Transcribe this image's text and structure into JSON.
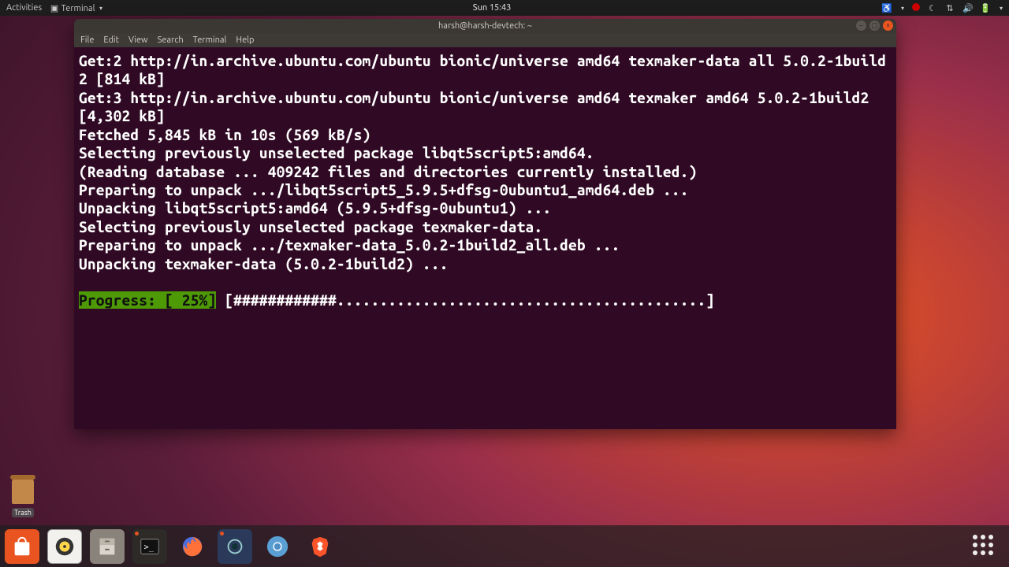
{
  "topbar": {
    "activities": "Activities",
    "app_indicator": "Terminal",
    "clock": "Sun 15:43"
  },
  "terminal": {
    "title": "harsh@harsh-devtech: ~",
    "menu": [
      "File",
      "Edit",
      "View",
      "Search",
      "Terminal",
      "Help"
    ],
    "lines": [
      "Get:2 http://in.archive.ubuntu.com/ubuntu bionic/universe amd64 texmaker-data all 5.0.2-1build2 [814 kB]",
      "Get:3 http://in.archive.ubuntu.com/ubuntu bionic/universe amd64 texmaker amd64 5.0.2-1build2 [4,302 kB]",
      "Fetched 5,845 kB in 10s (569 kB/s)",
      "Selecting previously unselected package libqt5script5:amd64.",
      "(Reading database ... 409242 files and directories currently installed.)",
      "Preparing to unpack .../libqt5script5_5.9.5+dfsg-0ubuntu1_amd64.deb ...",
      "Unpacking libqt5script5:amd64 (5.9.5+dfsg-0ubuntu1) ...",
      "Selecting previously unselected package texmaker-data.",
      "Preparing to unpack .../texmaker-data_5.0.2-1build2_all.deb ...",
      "Unpacking texmaker-data (5.0.2-1build2) ...",
      ""
    ],
    "progress": {
      "label": "Progress: [ 25%]",
      "bar": " [############...........................................]"
    }
  },
  "desktop": {
    "trash_label": "Trash"
  },
  "dock": {
    "apps": [
      {
        "name": "ubuntu-software"
      },
      {
        "name": "rhythmbox"
      },
      {
        "name": "files"
      },
      {
        "name": "terminal",
        "running": true
      },
      {
        "name": "firefox"
      },
      {
        "name": "obs-studio",
        "running": true
      },
      {
        "name": "chromium"
      },
      {
        "name": "brave"
      }
    ]
  }
}
